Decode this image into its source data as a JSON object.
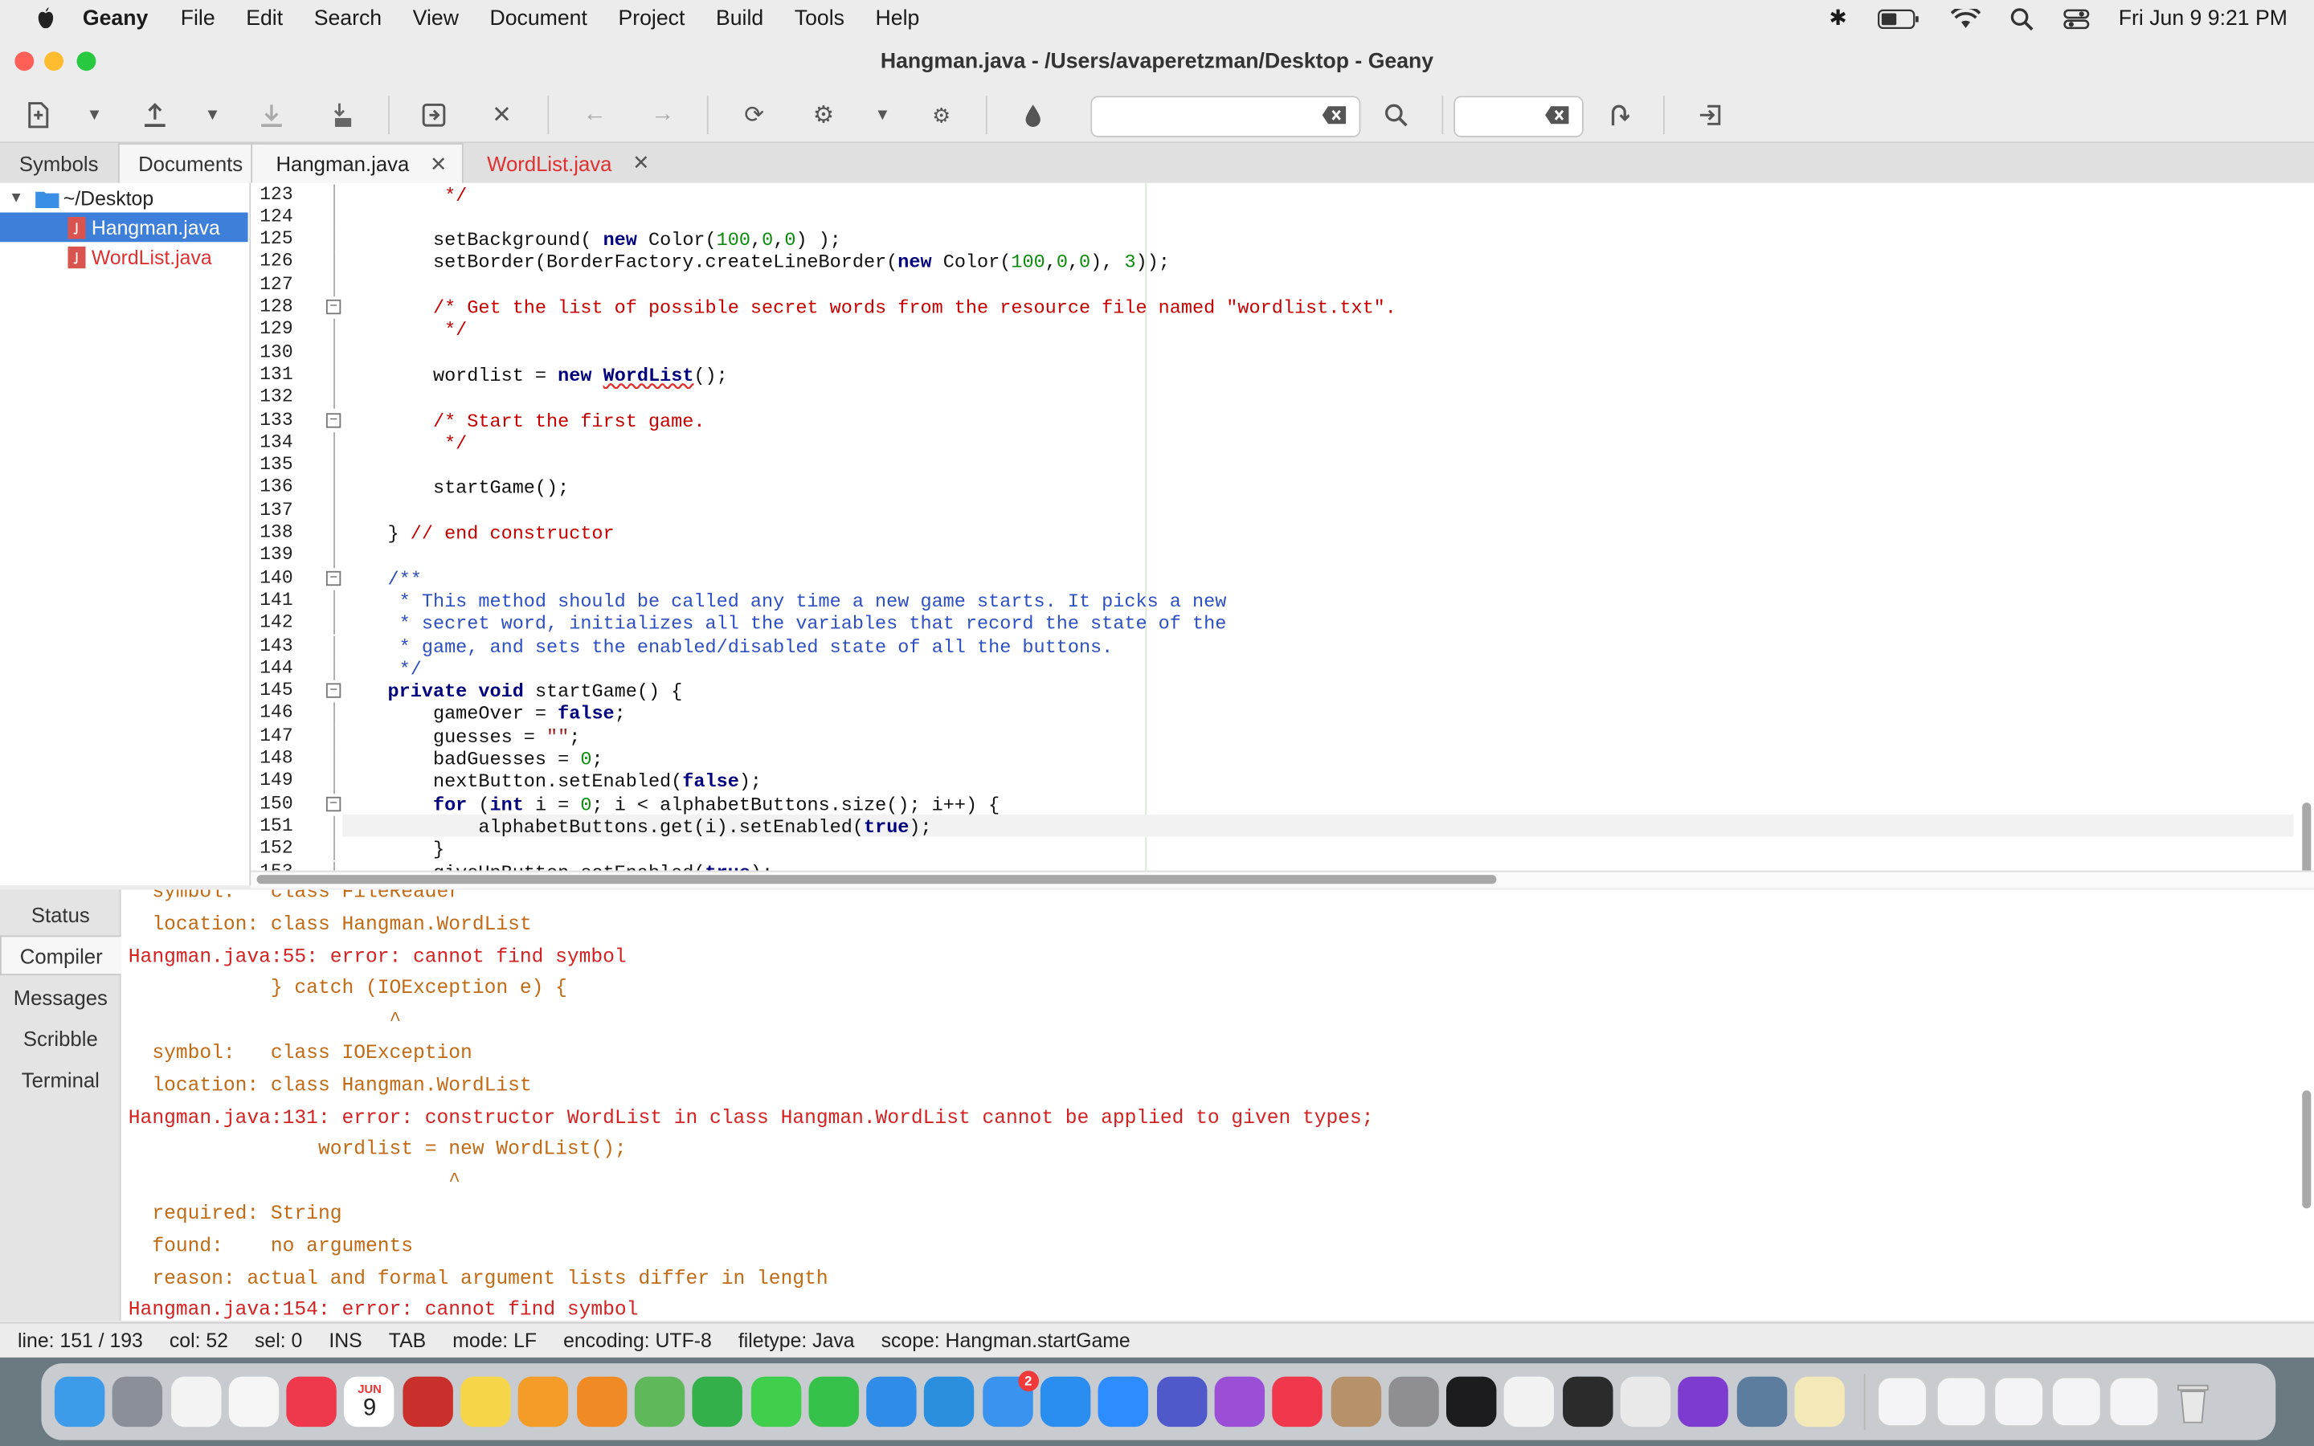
{
  "menubar": {
    "app": "Geany",
    "items": [
      "File",
      "Edit",
      "Search",
      "View",
      "Document",
      "Project",
      "Build",
      "Tools",
      "Help"
    ],
    "datetime": "Fri Jun 9  9:21 PM"
  },
  "window": {
    "title": "Hangman.java - /Users/avaperetzman/Desktop - Geany"
  },
  "sidebar": {
    "tabs": [
      "Symbols",
      "Documents"
    ],
    "folder": "~/Desktop",
    "files": [
      "Hangman.java",
      "WordList.java"
    ]
  },
  "editor_tabs": [
    {
      "label": "Hangman.java"
    },
    {
      "label": "WordList.java"
    }
  ],
  "editor": {
    "lines": [
      {
        "n": "123",
        "text": "         */"
      },
      {
        "n": "124",
        "text": ""
      },
      {
        "n": "125",
        "text": "        setBackground( new Color(100,0,0) );"
      },
      {
        "n": "126",
        "text": "        setBorder(BorderFactory.createLineBorder(new Color(100,0,0), 3));"
      },
      {
        "n": "127",
        "text": ""
      },
      {
        "n": "128",
        "text": "        /* Get the list of possible secret words from the resource file named \"wordlist.txt\"."
      },
      {
        "n": "129",
        "text": "         */"
      },
      {
        "n": "130",
        "text": ""
      },
      {
        "n": "131",
        "text": "        wordlist = new WordList();"
      },
      {
        "n": "132",
        "text": ""
      },
      {
        "n": "133",
        "text": "        /* Start the first game."
      },
      {
        "n": "134",
        "text": "         */"
      },
      {
        "n": "135",
        "text": ""
      },
      {
        "n": "136",
        "text": "        startGame();"
      },
      {
        "n": "137",
        "text": ""
      },
      {
        "n": "138",
        "text": "    } // end constructor"
      },
      {
        "n": "139",
        "text": ""
      },
      {
        "n": "140",
        "text": "    /**"
      },
      {
        "n": "141",
        "text": "     * This method should be called any time a new game starts. It picks a new"
      },
      {
        "n": "142",
        "text": "     * secret word, initializes all the variables that record the state of the"
      },
      {
        "n": "143",
        "text": "     * game, and sets the enabled/disabled state of all the buttons."
      },
      {
        "n": "144",
        "text": "     */"
      },
      {
        "n": "145",
        "text": "    private void startGame() {"
      },
      {
        "n": "146",
        "text": "        gameOver = false;"
      },
      {
        "n": "147",
        "text": "        guesses = \"\";"
      },
      {
        "n": "148",
        "text": "        badGuesses = 0;"
      },
      {
        "n": "149",
        "text": "        nextButton.setEnabled(false);"
      },
      {
        "n": "150",
        "text": "        for (int i = 0; i < alphabetButtons.size(); i++) {"
      },
      {
        "n": "151",
        "text": "            alphabetButtons.get(i).setEnabled(true);"
      },
      {
        "n": "152",
        "text": "        }"
      },
      {
        "n": "153",
        "text": "        giveUpButton.setEnabled(true);"
      }
    ]
  },
  "message_tabs": [
    "Status",
    "Compiler",
    "Messages",
    "Scribble",
    "Terminal"
  ],
  "compiler_output": [
    {
      "kind": "warn",
      "text": "  symbol:   class FileReader"
    },
    {
      "kind": "warn",
      "text": "  location: class Hangman.WordList"
    },
    {
      "kind": "err",
      "text": "Hangman.java:55: error: cannot find symbol"
    },
    {
      "kind": "warn",
      "text": "            } catch (IOException e) {"
    },
    {
      "kind": "warn",
      "text": "                      ^"
    },
    {
      "kind": "warn",
      "text": "  symbol:   class IOException"
    },
    {
      "kind": "warn",
      "text": "  location: class Hangman.WordList"
    },
    {
      "kind": "err",
      "text": "Hangman.java:131: error: constructor WordList in class Hangman.WordList cannot be applied to given types;"
    },
    {
      "kind": "warn",
      "text": "                wordlist = new WordList();"
    },
    {
      "kind": "warn",
      "text": "                           ^"
    },
    {
      "kind": "warn",
      "text": "  required: String"
    },
    {
      "kind": "warn",
      "text": "  found:    no arguments"
    },
    {
      "kind": "warn",
      "text": "  reason: actual and formal argument lists differ in length"
    },
    {
      "kind": "err",
      "text": "Hangman.java:154: error: cannot find symbol"
    }
  ],
  "statusbar": {
    "line": "line: 151 / 193",
    "col": "col: 52",
    "sel": "sel: 0",
    "ins": "INS",
    "tab": "TAB",
    "mode": "mode: LF",
    "encoding": "encoding: UTF-8",
    "filetype": "filetype: Java",
    "scope": "scope: Hangman.startGame"
  },
  "dock": {
    "calendar_month": "JUN",
    "calendar_day": "9",
    "mail_badge": "2",
    "apps": [
      "finder-icon",
      "launchpad-icon",
      "photos-icon",
      "reminders-icon",
      "news-icon",
      "calendar-icon",
      "photo-booth-icon",
      "notes-icon",
      "pages-icon",
      "books-icon",
      "maps-icon",
      "numbers-icon",
      "messages-icon",
      "facetime-icon",
      "safari-icon",
      "keynote-icon",
      "mail-icon",
      "app-store-icon",
      "zoom-icon",
      "teams-icon",
      "podcasts-icon",
      "music-icon",
      "contacts-icon",
      "system-preferences-icon",
      "apple-tv-icon",
      "textedit-icon",
      "terminal-icon",
      "chrome-icon",
      "github-desktop-icon",
      "preview-icon",
      "geany-icon"
    ]
  },
  "colors": {
    "error": "#d42222",
    "warning": "#c26a14",
    "keyword": "#00007f",
    "number": "#0a8c0a",
    "comment": "#c80000",
    "doc": "#2d4fc4",
    "active_file": "#e03030",
    "selection": "#3d7fd9"
  }
}
